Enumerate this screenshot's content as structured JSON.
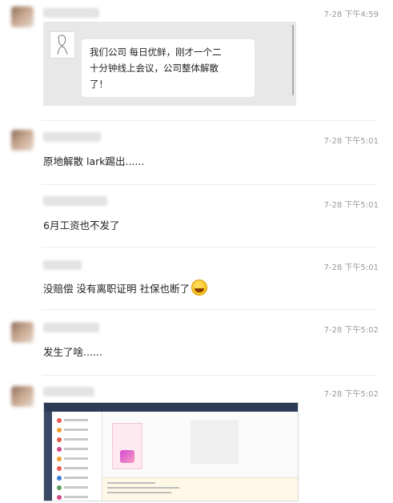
{
  "messages": [
    {
      "time": "7-28 下午4:59",
      "quote": {
        "text_lines": [
          "我们公司 每日优鲜，刚才一个二",
          "十分钟线上会议，公司整体解散",
          "了！"
        ]
      }
    },
    {
      "time": "7-28 下午5:01",
      "text": "原地解散 lark踢出......"
    },
    {
      "time": "7-28 下午5:01",
      "text": "6月工资也不发了"
    },
    {
      "time": "7-28 下午5:01",
      "text": "没赔偿 没有离职证明 社保也断了"
    },
    {
      "time": "7-28 下午5:02",
      "text": "发生了啥......"
    },
    {
      "time": "7-28 下午5:02",
      "image": "screenshot-thumbnail"
    }
  ],
  "icons": {
    "reaction": "laughing-tears-emoji",
    "quote_avatar": "sketch-avatar-icon"
  }
}
